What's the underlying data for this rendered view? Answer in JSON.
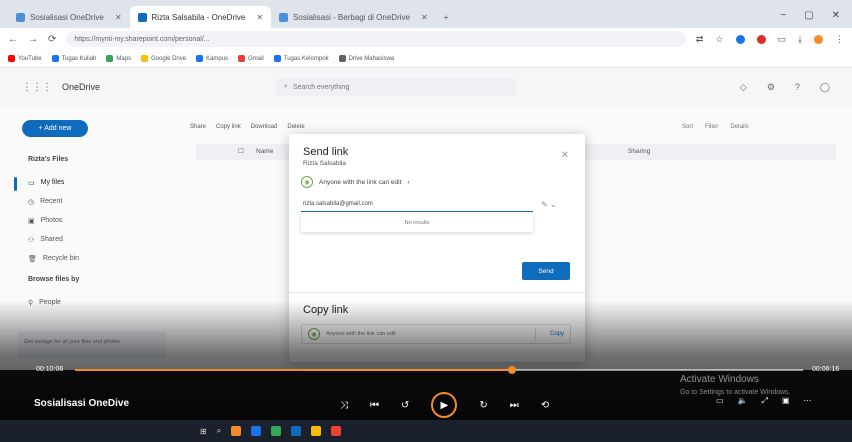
{
  "browser": {
    "tabs": [
      "Sosialisasi OneDrive",
      "Rizta Salsabila - OneDrive",
      "Sosialisasi - Berbagi di OneDrive"
    ],
    "address": "https://mynti-my.sharepoint.com/personal/...",
    "bookmarks": [
      "YouTube",
      "Tugas Kuliah",
      "Maps",
      "Google Drive",
      "Kampus",
      "Gmail",
      "Tugas Kelompok",
      "Drive Mahasiswa"
    ]
  },
  "onedrive": {
    "app_name": "OneDrive",
    "search_placeholder": "Search everything",
    "new_button": "+ Add new",
    "toolbar": [
      "Share",
      "Copy link",
      "Download",
      "Delete"
    ],
    "toolbar_right": [
      "Sort",
      "Filter",
      "Details"
    ],
    "sidebar_heading": "Rizta's Files",
    "sidebar_items": [
      "My files",
      "Recent",
      "Photos",
      "Shared",
      "Recycle bin"
    ],
    "browse_heading": "Browse files by",
    "browse_items": [
      "People"
    ],
    "promo": "Get storage for all your files and photos",
    "column_name": "Name",
    "column_sharing": "Sharing"
  },
  "dialog": {
    "title": "Send link",
    "subtitle": "Rizta Salsabila",
    "permission": "Anyone with the link can edit",
    "email_value": "rizta.salsabila@gmail.com",
    "suggestion": "No results",
    "send_label": "Send",
    "copy_title": "Copy link",
    "copy_permission": "Anyone with the link can edit",
    "copy_label": "Copy"
  },
  "video": {
    "title": "Sosialisasi OneDive",
    "elapsed": "00:10:06",
    "duration": "00:06:16",
    "progress": 0.6,
    "watermark_title": "Activate Windows",
    "watermark_sub": "Go to Settings to activate Windows."
  },
  "colors": {
    "accent": "#0f6cbd",
    "progress": "#f28c28"
  }
}
